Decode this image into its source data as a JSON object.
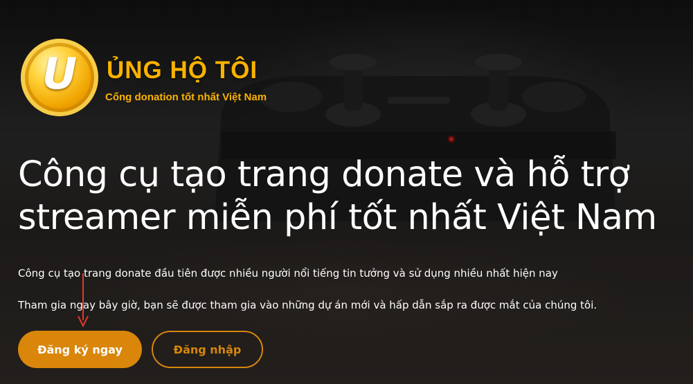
{
  "logo": {
    "coin_letter": "U",
    "title": "ỦNG HỘ TÔI",
    "tagline": "Cổng donation tốt nhất Việt Nam",
    "brand_color": "#f9b200"
  },
  "hero": {
    "headline_line1": "Công cụ tạo trang donate và hỗ trợ",
    "headline_line2": "streamer miễn phí tốt nhất Việt Nam",
    "description1": "Công cụ tạo trang donate đầu tiên được nhiều người nổi tiếng tin tưởng và sử dụng nhiều nhất hiện nay",
    "description2": "Tham gia ngay bây giờ, bạn sẽ được tham gia vào những dự án mới và hấp dẫn sắp ra được mắt của chúng tôi."
  },
  "actions": {
    "register_label": "Đăng ký ngay",
    "login_label": "Đăng nhập",
    "accent_color": "#d9860a"
  },
  "annotation": {
    "arrow_color": "#e0392b"
  }
}
